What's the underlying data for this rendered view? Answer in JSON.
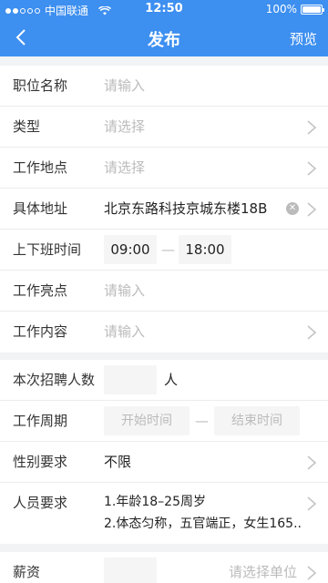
{
  "status": {
    "carrier": "中国联通",
    "time": "12:50",
    "battery": "100%"
  },
  "nav": {
    "title": "发布",
    "preview": "预览"
  },
  "form": {
    "job_title": {
      "label": "职位名称",
      "placeholder": "请输入"
    },
    "type": {
      "label": "类型",
      "placeholder": "请选择"
    },
    "location": {
      "label": "工作地点",
      "placeholder": "请选择"
    },
    "address": {
      "label": "具体地址",
      "value": "北京东路科技京城东楼18B"
    },
    "hours": {
      "label": "上下班时间",
      "start": "09:00",
      "separator": "—",
      "end": "18:00"
    },
    "highlights": {
      "label": "工作亮点",
      "placeholder": "请输入"
    },
    "content": {
      "label": "工作内容",
      "placeholder": "请输入"
    },
    "headcount": {
      "label": "本次招聘人数",
      "unit": "人"
    },
    "period": {
      "label": "工作周期",
      "start_placeholder": "开始时间",
      "separator": "—",
      "end_placeholder": "结束时间"
    },
    "gender": {
      "label": "性别要求",
      "value": "不限"
    },
    "requirements": {
      "label": "人员要求",
      "line1": "1.年龄18–25周岁",
      "line2": "2.体态匀称，五官端正，女生165..."
    },
    "salary": {
      "label": "薪资",
      "unit_placeholder": "请选择单位"
    }
  },
  "colors": {
    "primary": "#3d8ff0",
    "background": "#f2f3f5",
    "placeholder": "#bbbbbb"
  }
}
